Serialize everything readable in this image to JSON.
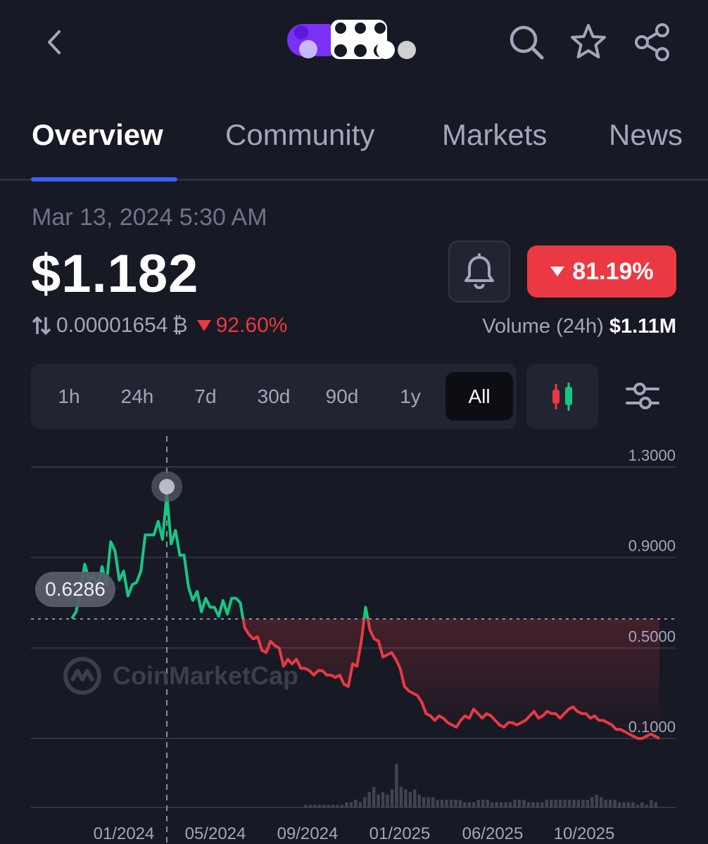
{
  "header": {
    "back_icon": "chevron-left-icon",
    "search_icon": "search-icon",
    "star_icon": "star-icon",
    "share_icon": "share-icon"
  },
  "tabs": [
    {
      "label": "Overview",
      "active": true
    },
    {
      "label": "Community",
      "active": false
    },
    {
      "label": "Markets",
      "active": false
    },
    {
      "label": "News",
      "active": false
    }
  ],
  "price": {
    "timestamp": "Mar 13, 2024 5:30 AM",
    "value": "$1.182",
    "btc_value": "0.00001654",
    "btc_symbol": "₿",
    "btc_change": "92.60%",
    "change_pct": "81.19%",
    "volume_label": "Volume (24h)",
    "volume_value": "$1.11M"
  },
  "colors": {
    "accent": "#3861fb",
    "up": "#16c784",
    "down": "#ea3943",
    "background": "#171924"
  },
  "range": {
    "options": [
      "1h",
      "24h",
      "7d",
      "30d",
      "90d",
      "1y",
      "All"
    ],
    "selected": "All"
  },
  "chart_data": {
    "type": "line",
    "y_ticks": [
      "1.3000",
      "0.9000",
      "0.5000",
      "0.1000"
    ],
    "ylim": [
      0.1,
      1.3
    ],
    "x_ticks": [
      "01/2024",
      "05/2024",
      "09/2024",
      "01/2025",
      "06/2025",
      "10/2025"
    ],
    "reference_value": 0.6286,
    "reference_label": "0.6286",
    "highlight_value": 1.182,
    "grid": true,
    "watermark": "CoinMarketCap",
    "series": [
      {
        "values": [
          0.63,
          0.66,
          0.75,
          0.87,
          0.8,
          0.82,
          0.77,
          0.86,
          0.78,
          0.97,
          0.93,
          0.8,
          0.84,
          0.73,
          0.78,
          0.79,
          0.84,
          1.0,
          1.0,
          1.0,
          1.06,
          0.98,
          1.18,
          0.96,
          1.02,
          0.91,
          0.91,
          0.77,
          0.71,
          0.75,
          0.66,
          0.72,
          0.68,
          0.68,
          0.64,
          0.71,
          0.65,
          0.72,
          0.72,
          0.7,
          0.59,
          0.56,
          0.54,
          0.55,
          0.49,
          0.48,
          0.53,
          0.51,
          0.5,
          0.42,
          0.45,
          0.43,
          0.45,
          0.41,
          0.41,
          0.4,
          0.38,
          0.4,
          0.4,
          0.38,
          0.38,
          0.37,
          0.38,
          0.34,
          0.33,
          0.43,
          0.42,
          0.53,
          0.68,
          0.58,
          0.54,
          0.53,
          0.46,
          0.47,
          0.48,
          0.45,
          0.41,
          0.33,
          0.31,
          0.3,
          0.29,
          0.26,
          0.21,
          0.2,
          0.18,
          0.2,
          0.19,
          0.17,
          0.16,
          0.15,
          0.18,
          0.2,
          0.19,
          0.23,
          0.21,
          0.19,
          0.21,
          0.2,
          0.18,
          0.16,
          0.15,
          0.17,
          0.17,
          0.16,
          0.17,
          0.18,
          0.2,
          0.22,
          0.19,
          0.2,
          0.22,
          0.21,
          0.21,
          0.19,
          0.21,
          0.23,
          0.24,
          0.22,
          0.21,
          0.21,
          0.19,
          0.2,
          0.18,
          0.18,
          0.17,
          0.16,
          0.14,
          0.14,
          0.13,
          0.12,
          0.11,
          0.1,
          0.1,
          0.11,
          0.12,
          0.11,
          0.1
        ]
      }
    ],
    "volume": [
      1,
      1,
      1,
      1,
      1,
      1,
      1,
      1,
      1,
      2,
      2,
      3,
      2,
      4,
      6,
      8,
      5,
      6,
      5,
      7,
      17,
      8,
      7,
      6,
      7,
      5,
      4,
      4,
      4,
      3,
      3,
      3,
      3,
      3,
      3,
      2,
      2,
      2,
      3,
      3,
      3,
      2,
      2,
      2,
      2,
      2,
      3,
      3,
      3,
      2,
      2,
      2,
      2,
      3,
      3,
      3,
      3,
      3,
      3,
      3,
      3,
      3,
      3,
      4,
      5,
      4,
      3,
      3,
      3,
      2,
      2,
      2,
      2,
      1,
      2,
      1,
      3,
      2
    ]
  }
}
